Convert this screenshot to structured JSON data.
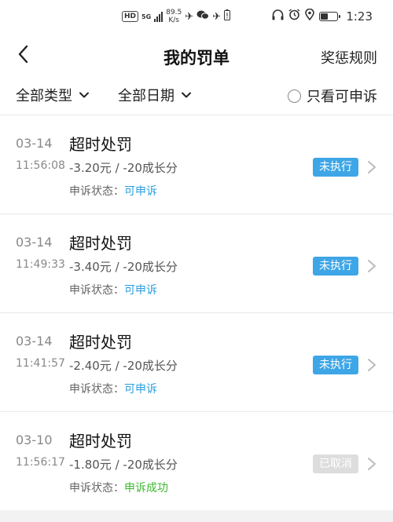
{
  "status_bar": {
    "network_badge": "HD",
    "network_type": "5G",
    "network_speed": "89.5",
    "network_speed_unit": "K/s",
    "time": "1:23",
    "battery_level": 0.4,
    "icons": [
      "airplane-icon",
      "wechat-icon",
      "airplane-icon",
      "battery-alert-icon",
      "headphones-icon",
      "alarm-icon",
      "location-icon"
    ]
  },
  "header": {
    "title": "我的罚单",
    "rules_label": "奖惩规则"
  },
  "filters": {
    "type_label": "全部类型",
    "date_label": "全部日期",
    "appeal_only_label": "只看可申诉"
  },
  "colors": {
    "badge_pending": "#3ea6e6",
    "badge_cancelled": "#dddddd",
    "appeal_available": "#2a9fe0",
    "appeal_success": "#3cba2e"
  },
  "penalties": [
    {
      "date": "03-14",
      "time": "11:56:08",
      "title": "超时处罚",
      "amount": "-3.20元 / -20成长分",
      "appeal_prefix": "申诉状态：",
      "appeal_status": "可申诉",
      "badge": "未执行",
      "state": "pending"
    },
    {
      "date": "03-14",
      "time": "11:49:33",
      "title": "超时处罚",
      "amount": "-3.40元 / -20成长分",
      "appeal_prefix": "申诉状态：",
      "appeal_status": "可申诉",
      "badge": "未执行",
      "state": "pending"
    },
    {
      "date": "03-14",
      "time": "11:41:57",
      "title": "超时处罚",
      "amount": "-2.40元 / -20成长分",
      "appeal_prefix": "申诉状态：",
      "appeal_status": "可申诉",
      "badge": "未执行",
      "state": "pending"
    },
    {
      "date": "03-10",
      "time": "11:56:17",
      "title": "超时处罚",
      "amount": "-1.80元 / -20成长分",
      "appeal_prefix": "申诉状态：",
      "appeal_status": "申诉成功",
      "badge": "已取消",
      "state": "cancelled"
    }
  ]
}
